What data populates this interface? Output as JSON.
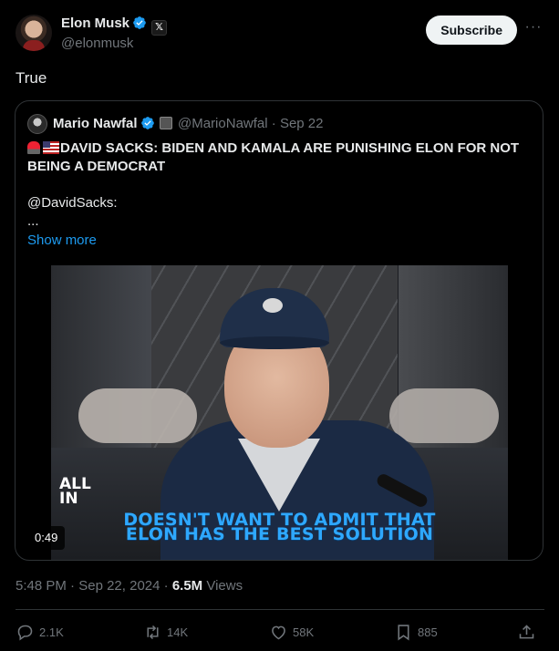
{
  "author": {
    "name": "Elon Musk",
    "handle": "@elonmusk",
    "x_badge": "𝕏",
    "subscribe_label": "Subscribe",
    "more_label": "···"
  },
  "tweet": {
    "text": "True"
  },
  "quoted": {
    "name": "Mario Nawfal",
    "handle": "@MarioNawfal",
    "date": "Sep 22",
    "headline": "DAVID SACKS: BIDEN AND KAMALA ARE PUNISHING ELON FOR NOT BEING A DEMOCRAT",
    "mention": "@DavidSacks:",
    "ellipsis": "...",
    "show_more": "Show more",
    "video": {
      "logo_line1": "ALL",
      "logo_line2": "IN",
      "caption_line1": "DOESN'T WANT TO ADMIT THAT",
      "caption_line2": "ELON HAS THE BEST SOLUTION",
      "duration": "0:49"
    }
  },
  "meta": {
    "time": "5:48 PM",
    "date": "Sep 22, 2024",
    "views_count": "6.5M",
    "views_label": "Views"
  },
  "actions": {
    "replies": "2.1K",
    "reposts": "14K",
    "likes": "58K",
    "bookmarks": "885"
  },
  "colors": {
    "accent": "#1d9bf0",
    "muted": "#71767b",
    "text": "#e7e9ea",
    "border": "#2f3336"
  }
}
